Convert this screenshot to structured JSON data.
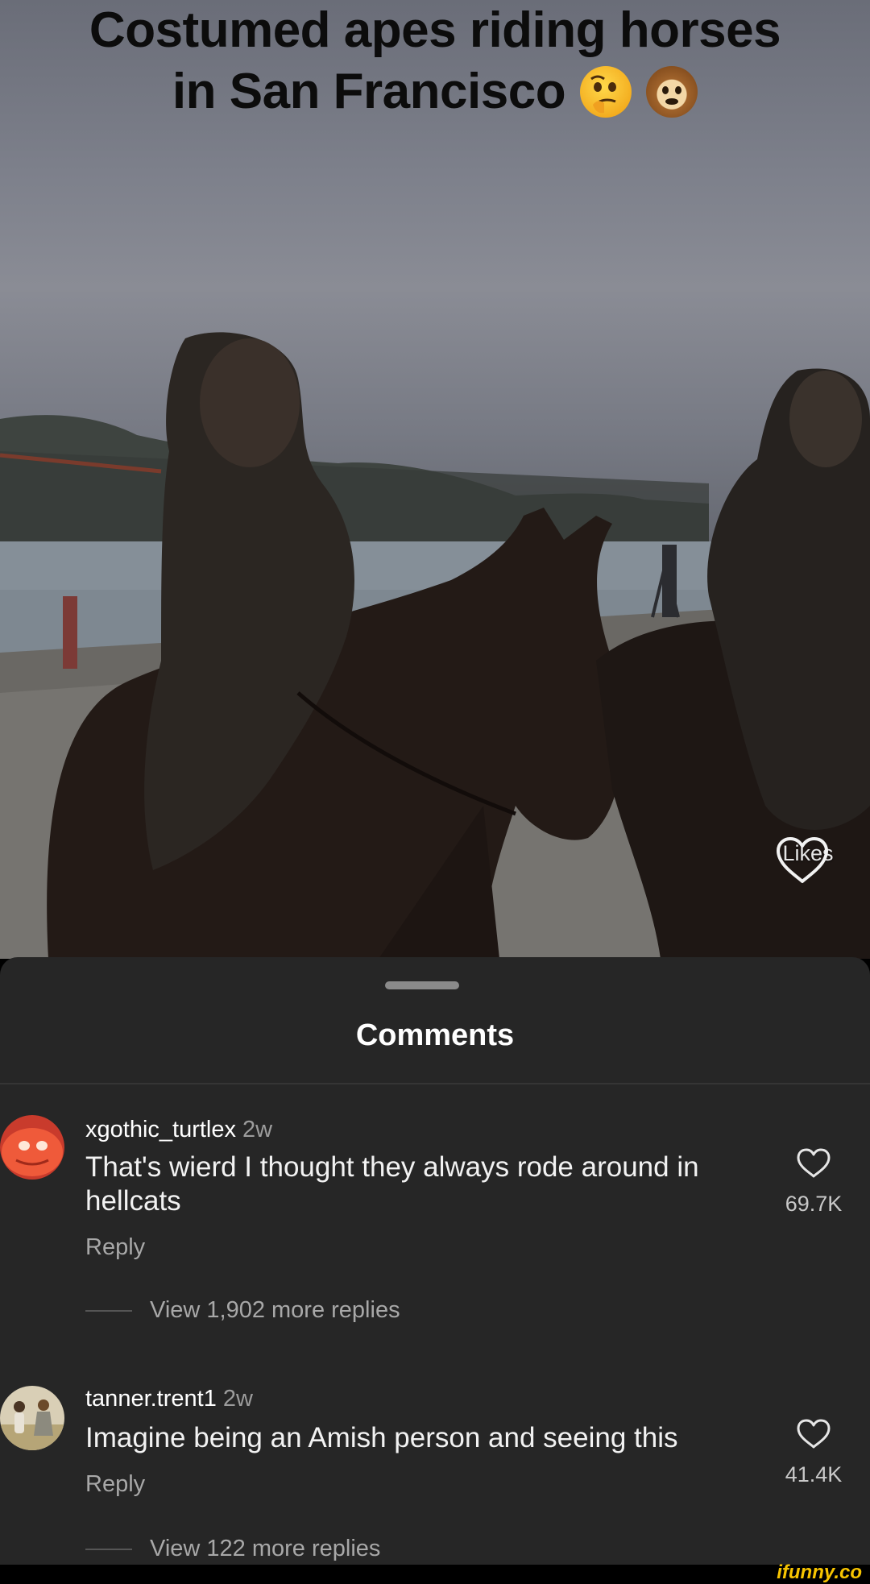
{
  "video": {
    "caption_line1": "Costumed apes riding horses",
    "caption_line2": "in San Francisco",
    "caption_emojis": [
      "thinking-face",
      "monkey-face"
    ],
    "likes_label": "Likes",
    "likes_icon": "heart-outline-icon"
  },
  "sheet": {
    "title": "Comments"
  },
  "comments": [
    {
      "username": "xgothic_turtlex",
      "time": "2w",
      "text": "That's wierd I thought they always rode around in hellcats",
      "reply_label": "Reply",
      "like_count": "69.7K",
      "view_replies": "View 1,902 more replies"
    },
    {
      "username": "tanner.trent1",
      "time": "2w",
      "text": "Imagine being an Amish person and seeing this",
      "reply_label": "Reply",
      "like_count": "41.4K",
      "view_replies": "View 122 more replies"
    }
  ],
  "watermark": "ifunny.co",
  "colors": {
    "sheet_background": "#262626",
    "watermark": "#f7c400"
  }
}
